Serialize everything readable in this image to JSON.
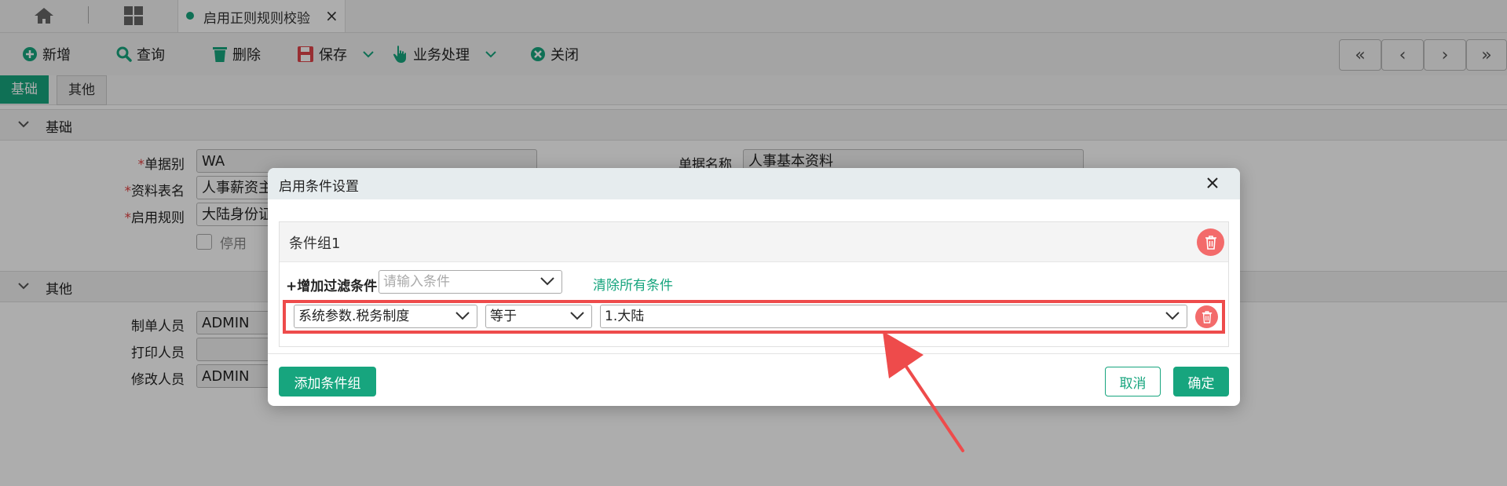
{
  "tabbar": {
    "tab_title": "启用正则规则校验",
    "tab_close": "×"
  },
  "toolbar": {
    "new": "新增",
    "query": "查询",
    "delete": "删除",
    "save": "保存",
    "business": "业务处理",
    "close": "关闭",
    "nav": [
      "«",
      "‹",
      "›",
      "»"
    ]
  },
  "subtabs": {
    "basic": "基础",
    "other": "其他"
  },
  "sections": {
    "basic": "基础",
    "other": "其他"
  },
  "form": {
    "doc_type_label": "单据别",
    "doc_type_value": "WA",
    "doc_name_label": "单据名称",
    "doc_name_value": "人事基本资料",
    "table_label": "资料表名",
    "table_value": "人事薪资主",
    "rule_label": "启用规则",
    "rule_value": "大陆身份证",
    "disable_label": "停用",
    "creator_label": "制单人员",
    "creator_value": "ADMIN",
    "printer_label": "打印人员",
    "printer_value": "",
    "modifier_label": "修改人员",
    "modifier_value": "ADMIN"
  },
  "colors": {
    "accent": "#17a57e",
    "danger": "#f36b6b",
    "highlight": "#ee4b4b"
  },
  "modal": {
    "title": "启用条件设置",
    "group_title": "条件组1",
    "add_filter": "+增加过滤条件",
    "filter_placeholder": "请输入条件",
    "clear_all": "清除所有条件",
    "condition_field": "系统参数.税务制度",
    "condition_operator": "等于",
    "condition_value": "1.大陆",
    "add_group": "添加条件组",
    "cancel": "取消",
    "confirm": "确定"
  }
}
